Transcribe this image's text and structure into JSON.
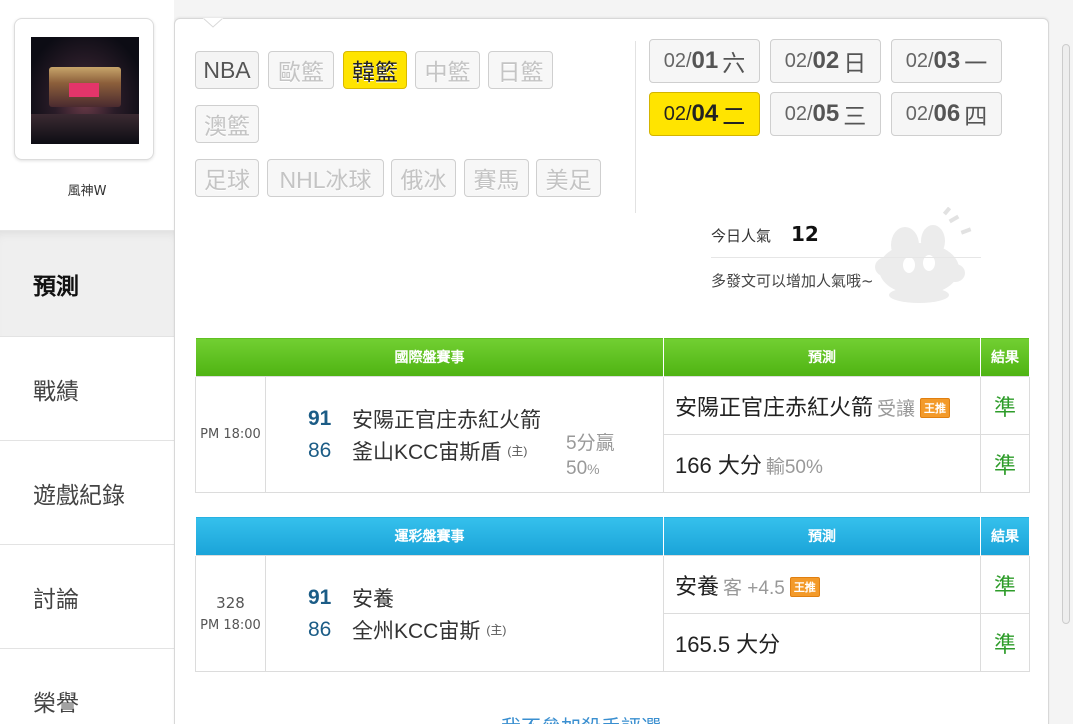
{
  "user": {
    "name": "風神W"
  },
  "sidebar": {
    "items": [
      {
        "label": "預測",
        "active": true
      },
      {
        "label": "戰績",
        "active": false
      },
      {
        "label": "遊戲紀錄",
        "active": false
      },
      {
        "label": "討論",
        "active": false
      },
      {
        "label": "榮譽",
        "active": false
      }
    ]
  },
  "leagues": [
    {
      "label": "NBA",
      "state": "enabled"
    },
    {
      "label": "歐籃",
      "state": "disabled"
    },
    {
      "label": "韓籃",
      "state": "active"
    },
    {
      "label": "中籃",
      "state": "disabled"
    },
    {
      "label": "日籃",
      "state": "disabled"
    },
    {
      "label": "澳籃",
      "state": "disabled"
    },
    {
      "label": "足球",
      "state": "disabled"
    },
    {
      "label": "NHL冰球",
      "state": "disabled"
    },
    {
      "label": "俄冰",
      "state": "disabled"
    },
    {
      "label": "賽馬",
      "state": "disabled"
    },
    {
      "label": "美足",
      "state": "disabled"
    }
  ],
  "dates": [
    {
      "month": "02/",
      "day": "01",
      "weekday": "六",
      "active": false
    },
    {
      "month": "02/",
      "day": "02",
      "weekday": "日",
      "active": false
    },
    {
      "month": "02/",
      "day": "03",
      "weekday": "一",
      "active": false
    },
    {
      "month": "02/",
      "day": "04",
      "weekday": "二",
      "active": true
    },
    {
      "month": "02/",
      "day": "05",
      "weekday": "三",
      "active": false
    },
    {
      "month": "02/",
      "day": "06",
      "weekday": "四",
      "active": false
    }
  ],
  "popularity": {
    "label": "今日人氣",
    "value": "12",
    "tip": "多發文可以增加人氣哦~"
  },
  "international": {
    "headers": {
      "event": "國際盤賽事",
      "prediction": "預測",
      "result": "結果"
    },
    "game": {
      "time": "PM 18:00",
      "away": {
        "score": "91",
        "name": "安陽正官庄赤紅火箭"
      },
      "home": {
        "score": "86",
        "name": "釜山KCC宙斯盾",
        "host_tag": "(主)"
      },
      "spread": {
        "line1": "5分贏",
        "pct_value": "50",
        "pct_unit": "%"
      },
      "predictions": [
        {
          "main": "安陽正官庄赤紅火箭",
          "sub": "受讓",
          "badge": "王推",
          "result": "準"
        },
        {
          "main": "166 大分",
          "sub": "輸50%",
          "result": "準"
        }
      ]
    }
  },
  "sports_lottery": {
    "headers": {
      "event": "運彩盤賽事",
      "prediction": "預測",
      "result": "結果"
    },
    "game": {
      "number": "328",
      "time": "PM 18:00",
      "away": {
        "score": "91",
        "name": "安養"
      },
      "home": {
        "score": "86",
        "name": "全州KCC宙斯",
        "host_tag": "(主)"
      },
      "predictions": [
        {
          "main": "安養",
          "sub": "客 +4.5",
          "badge": "王推",
          "result": "準"
        },
        {
          "main": "165.5 大分",
          "result": "準"
        }
      ]
    }
  },
  "footer_link": {
    "label": "我不參加殺手評選"
  },
  "colors": {
    "active": "#ffe400",
    "green_header": "#4eb312",
    "blue_header": "#1aa3d8",
    "result_green": "#2e9c2a",
    "badge_orange": "#f39a2a"
  },
  "icons": {
    "chevron": "chevron-down-icon",
    "mascot": "mascot-icon"
  }
}
